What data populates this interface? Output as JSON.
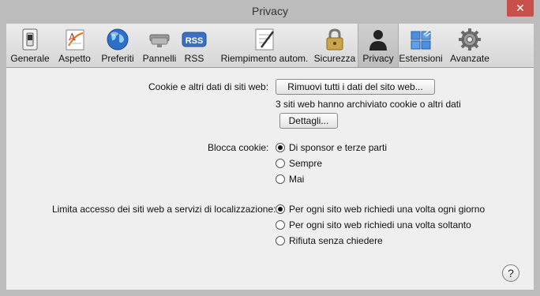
{
  "window": {
    "title": "Privacy",
    "close_glyph": "✕"
  },
  "toolbar": {
    "items": [
      {
        "label": "Generale",
        "icon": "switch-icon"
      },
      {
        "label": "Aspetto",
        "icon": "font-style-icon"
      },
      {
        "label": "Preferiti",
        "icon": "globe-icon"
      },
      {
        "label": "Pannelli",
        "icon": "tabs-icon"
      },
      {
        "label": "RSS",
        "icon": "rss-icon",
        "icon_text": "RSS"
      },
      {
        "label": "Riempimento autom.",
        "icon": "autofill-pen-icon"
      },
      {
        "label": "Sicurezza",
        "icon": "padlock-icon"
      },
      {
        "label": "Privacy",
        "icon": "person-silhouette-icon",
        "selected": true
      },
      {
        "label": "Estensioni",
        "icon": "puzzle-icon"
      },
      {
        "label": "Avanzate",
        "icon": "gear-icon"
      }
    ]
  },
  "cookies": {
    "label": "Cookie e altri dati di siti web:",
    "remove_button": "Rimuovi tutti i dati del sito web...",
    "info": "3 siti web hanno archiviato cookie o altri dati",
    "details_button": "Dettagli..."
  },
  "block_cookies": {
    "label": "Blocca cookie:",
    "options": [
      {
        "label": "Di sponsor e terze parti",
        "selected": true
      },
      {
        "label": "Sempre",
        "selected": false
      },
      {
        "label": "Mai",
        "selected": false
      }
    ]
  },
  "location": {
    "label": "Limita accesso dei siti web a servizi di localizzazione:",
    "options": [
      {
        "label": "Per ogni sito web richiedi una volta ogni giorno",
        "selected": true
      },
      {
        "label": "Per ogni sito web richiedi una volta soltanto",
        "selected": false
      },
      {
        "label": "Rifiuta senza chiedere",
        "selected": false
      }
    ]
  },
  "help": {
    "label": "?"
  },
  "colors": {
    "window_bg": "#bcbcbc",
    "content_bg": "#efefef",
    "close": "#c7504a"
  }
}
